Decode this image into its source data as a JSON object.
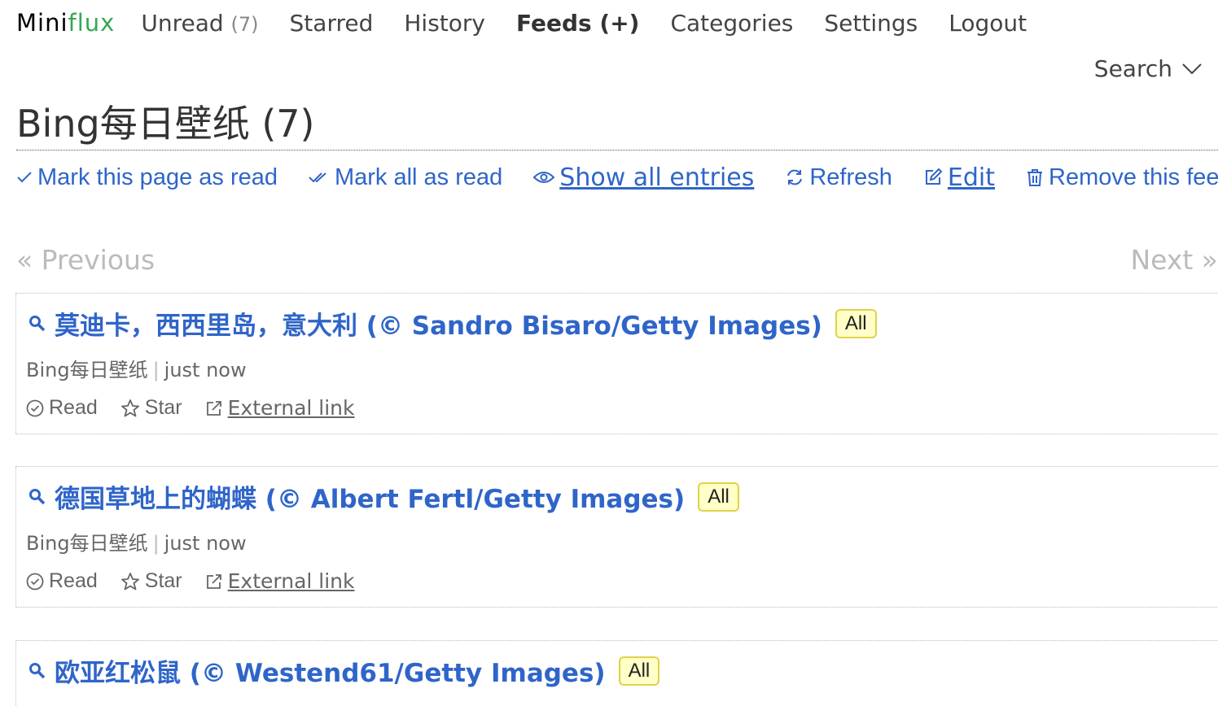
{
  "header": {
    "logo_part1": "Mini",
    "logo_part2": "flux",
    "nav": {
      "unread": "Unread",
      "unread_count": "(7)",
      "starred": "Starred",
      "history": "History",
      "feeds": "Feeds (+)",
      "categories": "Categories",
      "settings": "Settings",
      "logout": "Logout"
    },
    "search": "Search"
  },
  "page": {
    "title": "Bing每日壁纸 (7)"
  },
  "actions": {
    "mark_page_read": "Mark this page as read",
    "mark_all_read": "Mark all as read",
    "show_all": "Show all entries",
    "refresh": "Refresh",
    "edit": "Edit",
    "remove": "Remove this feed"
  },
  "pagination": {
    "previous": "« Previous",
    "next": "Next »"
  },
  "entries": [
    {
      "title": "莫迪卡，西西里岛，意大利 (© Sandro Bisaro/Getty Images)",
      "badge": "All",
      "feed": "Bing每日壁纸",
      "time": "just now",
      "read": "Read",
      "star": "Star",
      "external": "External link"
    },
    {
      "title": "德国草地上的蝴蝶 (© Albert Fertl/Getty Images)",
      "badge": "All",
      "feed": "Bing每日壁纸",
      "time": "just now",
      "read": "Read",
      "star": "Star",
      "external": "External link"
    },
    {
      "title": "欧亚红松鼠 (© Westend61/Getty Images)",
      "badge": "All"
    }
  ],
  "colors": {
    "link": "#2f65c9",
    "logo_accent": "#33a852",
    "badge_bg": "#ffffc7",
    "badge_border": "#e0d24a"
  }
}
